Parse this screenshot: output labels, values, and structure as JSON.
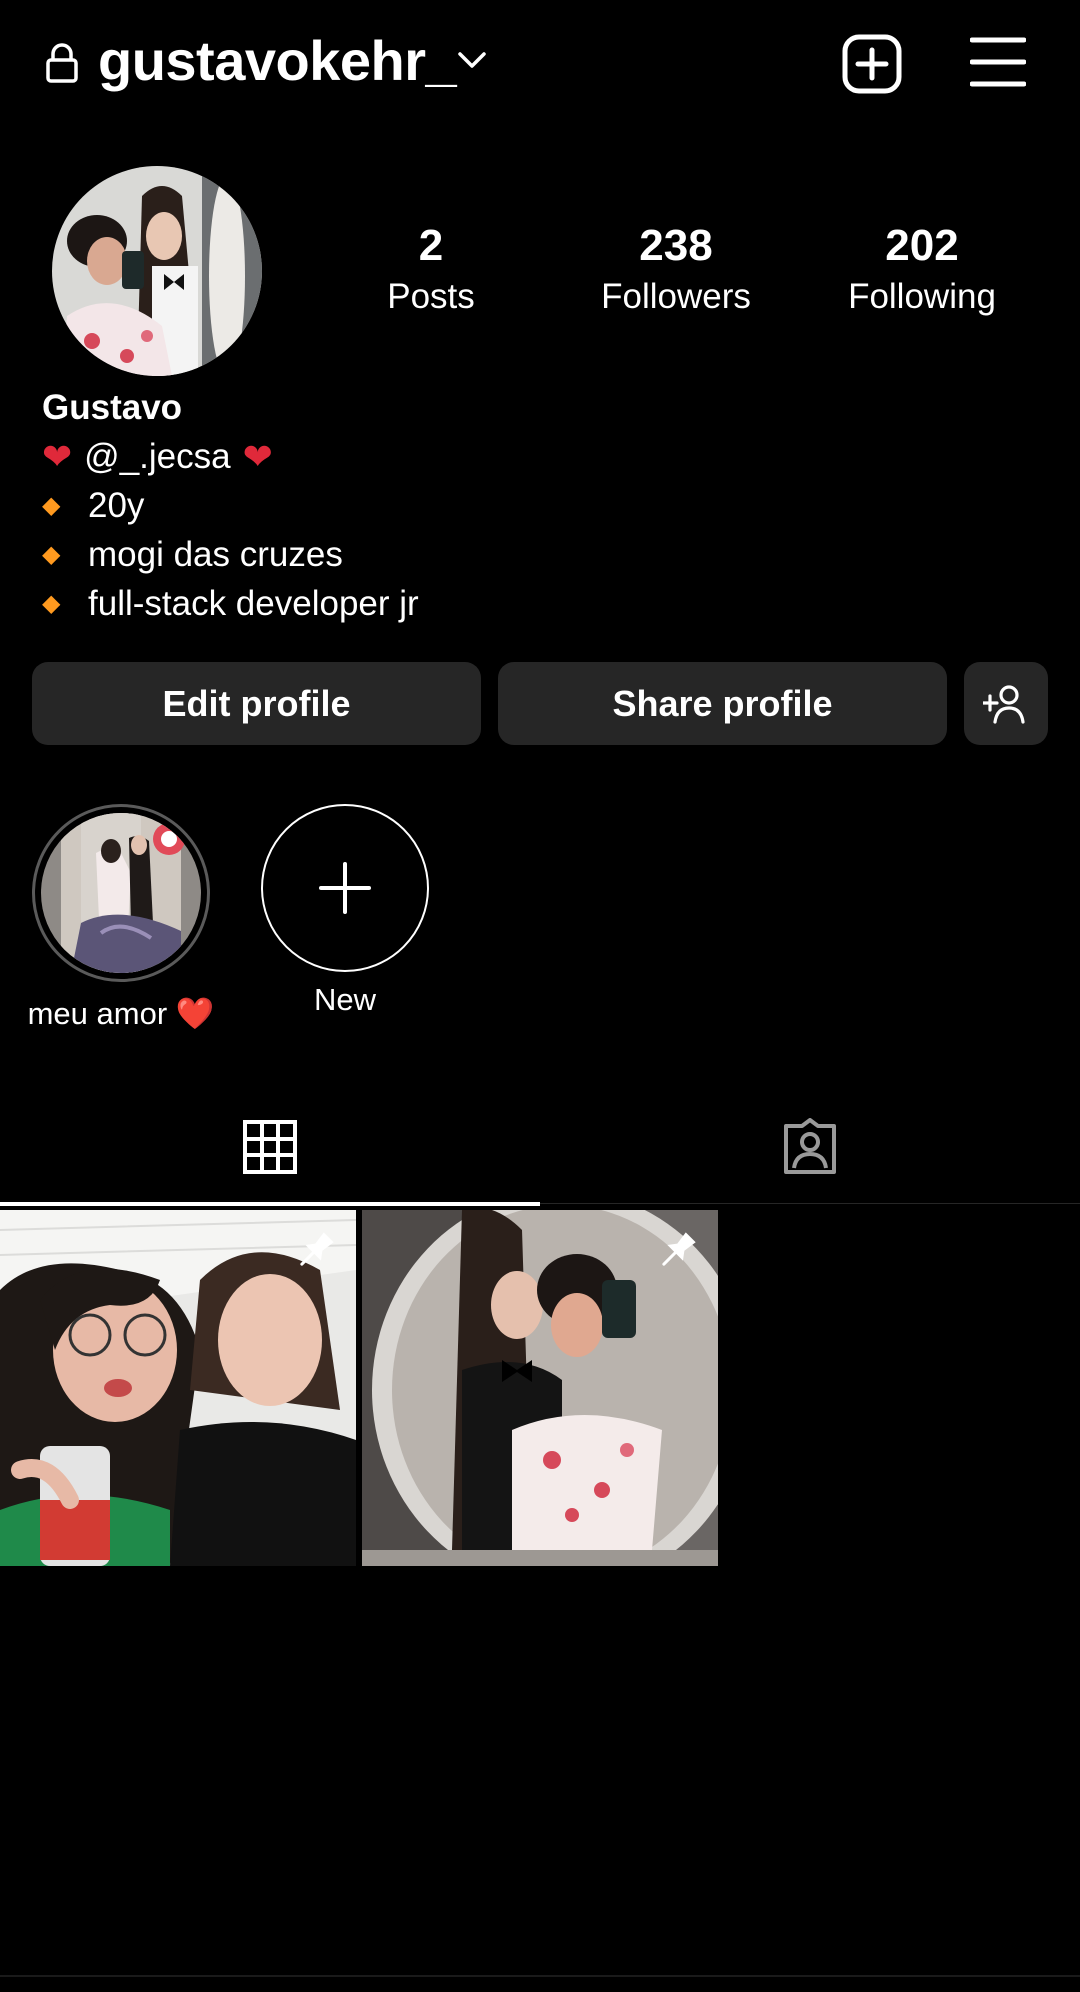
{
  "header": {
    "username": "gustavokehr_",
    "icons": [
      "lock-icon",
      "chevron-down-icon",
      "new-post-icon",
      "menu-icon"
    ]
  },
  "stats": {
    "posts": {
      "value": "2",
      "label": "Posts"
    },
    "followers": {
      "value": "238",
      "label": "Followers"
    },
    "following": {
      "value": "202",
      "label": "Following"
    }
  },
  "bio": {
    "name": "Gustavo",
    "mention": "@_.jecsa",
    "lines": [
      "20y",
      "mogi das cruzes",
      "full-stack developer jr"
    ],
    "heart_emoji": "❤️",
    "bullet_emoji": "🔸"
  },
  "buttons": {
    "edit": "Edit profile",
    "share": "Share profile"
  },
  "highlights": [
    {
      "label": "meu amor ❤️"
    },
    {
      "label": "New"
    }
  ],
  "tabs": [
    "grid-icon",
    "tagged-icon"
  ],
  "colors": {
    "background": "#000000",
    "button": "#262626",
    "heart": "#e0293a",
    "bullet": "#ff9a1f"
  }
}
